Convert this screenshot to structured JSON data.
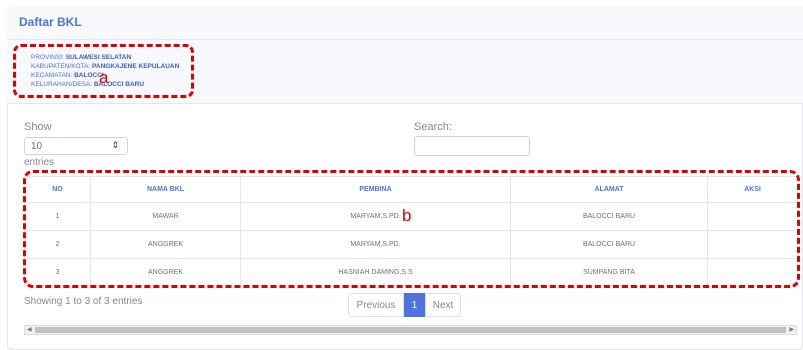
{
  "card": {
    "title": "Daftar BKL"
  },
  "info": {
    "provinsi_label": "PROVINSI:",
    "provinsi_value": "SULAWESI SELATAN",
    "kabupaten_label": "KABUPATEN/KOTA:",
    "kabupaten_value": "PANGKAJENE KEPULAUAN",
    "kecamatan_label": "KECAMATAN:",
    "kecamatan_value": "BALOCCI",
    "kelurahan_label": "KELURAHAN/DESA:",
    "kelurahan_value": "BALOCCI BARU"
  },
  "annotations": {
    "a": "a",
    "b": "b",
    "color": "#e00000"
  },
  "controls": {
    "show_label": "Show",
    "page_size": "10",
    "entries_label": "entries",
    "search_label": "Search:",
    "search_value": ""
  },
  "table": {
    "headers": [
      "NO",
      "NAMA BKL",
      "PEMBINA",
      "ALAMAT",
      "AKSI"
    ],
    "rows": [
      [
        "1",
        "MAWAR",
        "MARYAM,S.PD.",
        "BALOCCI BARU",
        ""
      ],
      [
        "2",
        "ANGGREK",
        "MARYAM,S.PD.",
        "BALOCCI BARU",
        ""
      ],
      [
        "3",
        "ANGGREK",
        "HASNIAH DAMING,S.S",
        "SUMPANG BITA",
        ""
      ]
    ]
  },
  "footer": {
    "showing_text": "Showing 1 to 3 of 3 entries",
    "prev_label": "Previous",
    "current_page": "1",
    "next_label": "Next"
  },
  "colors": {
    "accent": "#4e73df",
    "muted": "#858796"
  }
}
